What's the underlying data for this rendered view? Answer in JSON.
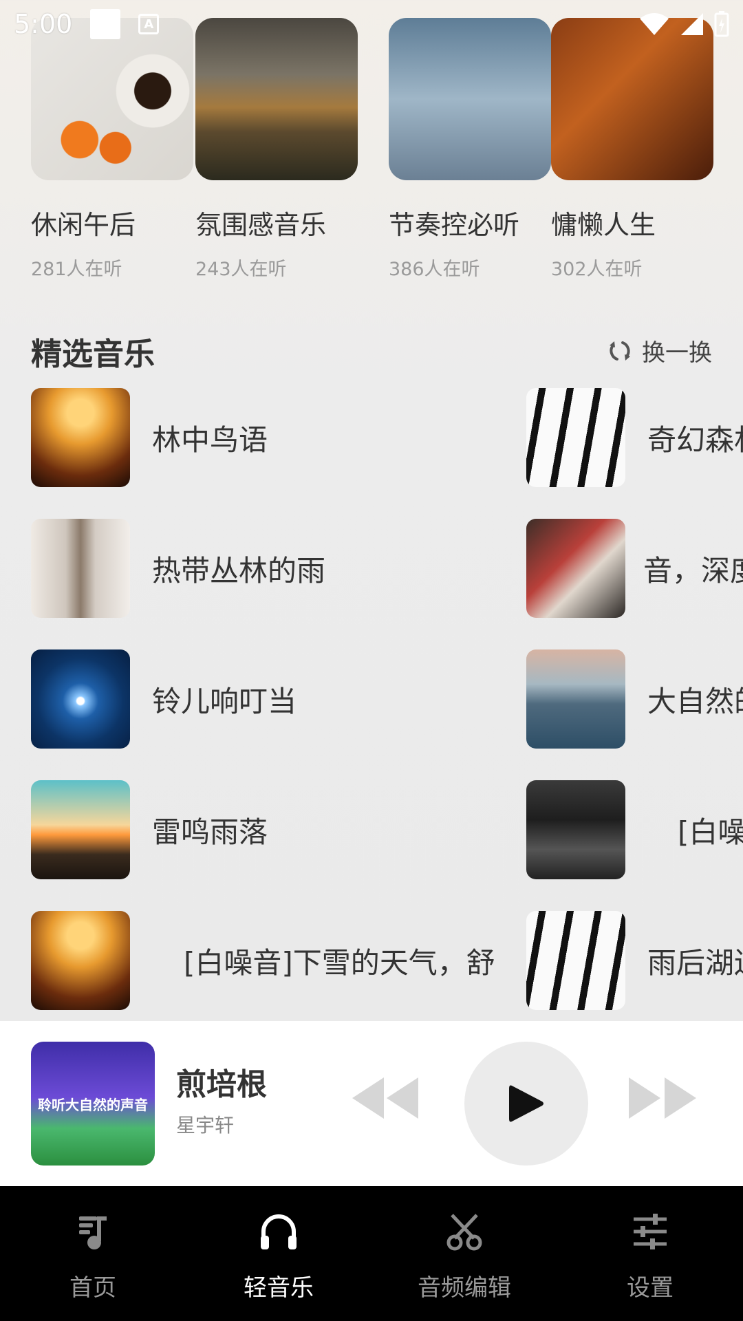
{
  "status_bar": {
    "time": "5:00"
  },
  "playlists": [
    {
      "title": "休闲午后",
      "count": "281人在听"
    },
    {
      "title": "氛围感音乐",
      "count": "243人在听"
    },
    {
      "title": "节奏控必听",
      "count": "386人在听"
    },
    {
      "title": "慵懒人生",
      "count": "302人在听"
    }
  ],
  "section": {
    "title": "精选音乐",
    "refresh_label": "换一换"
  },
  "songs_left": [
    {
      "title": "林中鸟语"
    },
    {
      "title": "热带丛林的雨"
    },
    {
      "title": "铃儿响叮当"
    },
    {
      "title": "雷鸣雨落"
    },
    {
      "title": "[白噪音]下雪的天气，舒"
    }
  ],
  "songs_right": [
    {
      "title": "奇幻森林"
    },
    {
      "title": "音，深度"
    },
    {
      "title": "大自然的"
    },
    {
      "title": "[白噪"
    },
    {
      "title": "雨后湖边"
    }
  ],
  "player": {
    "cover_text": "聆听大自然的声音",
    "title": "煎培根",
    "artist": "星宇轩"
  },
  "nav": [
    {
      "label": "首页",
      "icon": "music-note-icon",
      "active": false
    },
    {
      "label": "轻音乐",
      "icon": "headphones-icon",
      "active": true
    },
    {
      "label": "音频编辑",
      "icon": "scissors-icon",
      "active": false
    },
    {
      "label": "设置",
      "icon": "sliders-icon",
      "active": false
    }
  ]
}
